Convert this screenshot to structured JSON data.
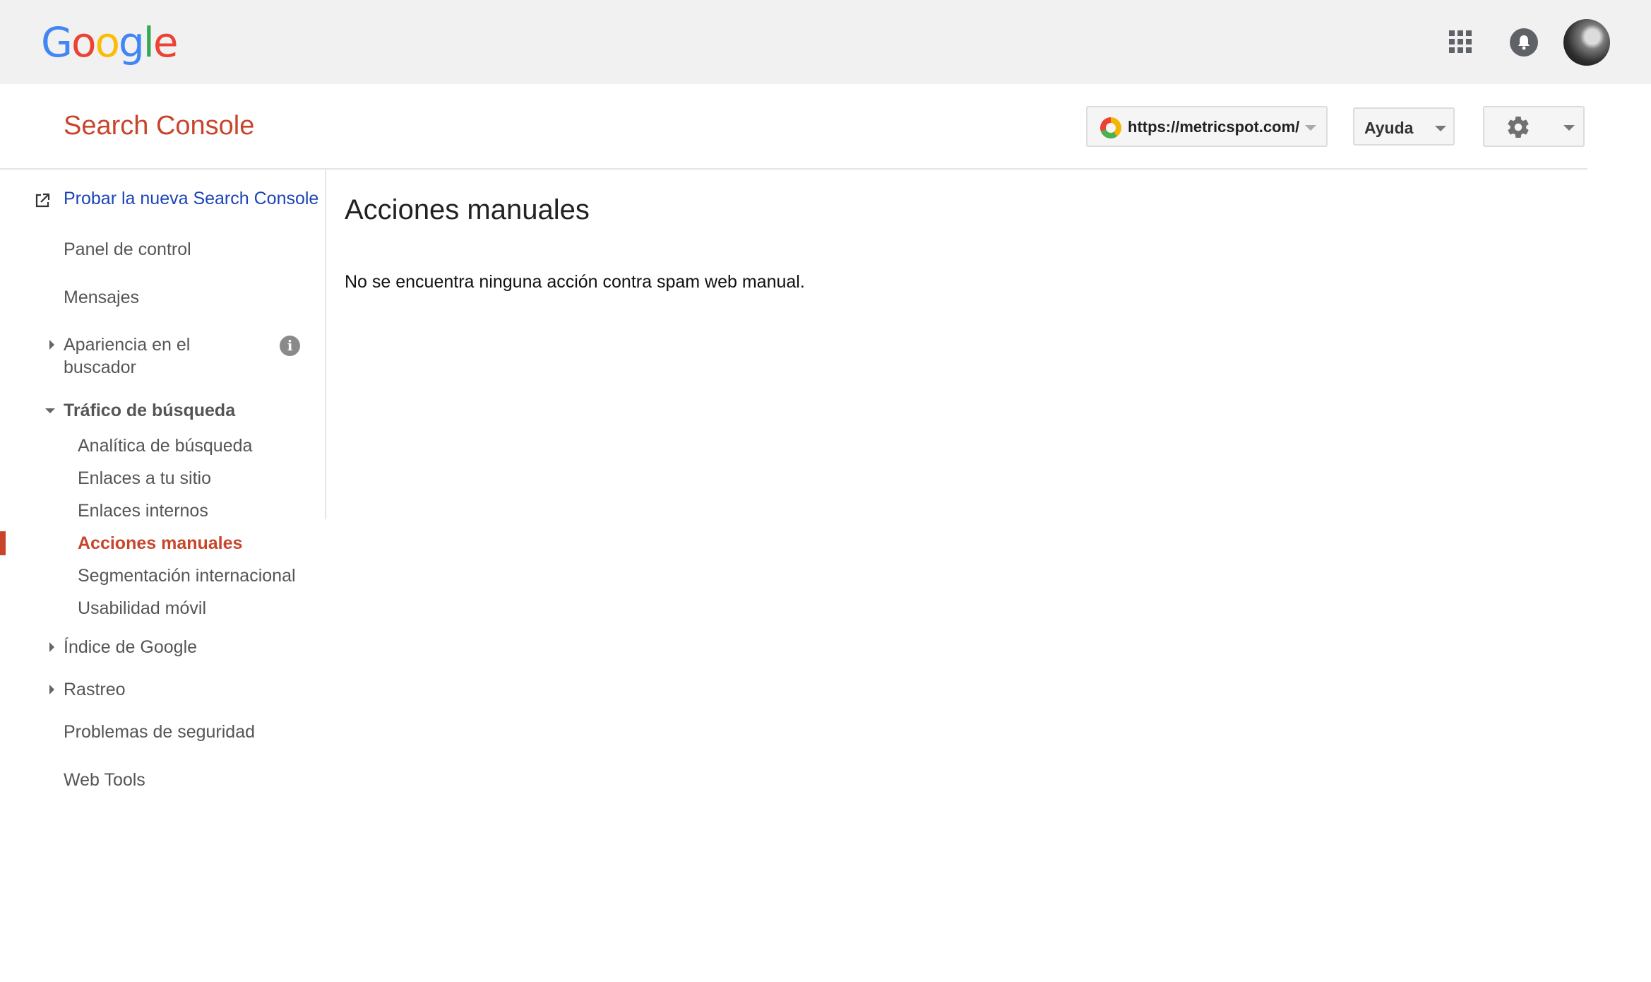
{
  "topbar": {
    "logo_letters": [
      "G",
      "o",
      "o",
      "g",
      "l",
      "e"
    ],
    "icons": {
      "apps": "apps-grid-icon",
      "notifications": "bell-icon",
      "account": "avatar"
    }
  },
  "header": {
    "product_title": "Search Console",
    "site_selector": "https://metricspot.com/",
    "help_label": "Ayuda",
    "settings_icon": "gear-icon"
  },
  "sidebar": {
    "new_console_link": "Probar la nueva Search Console",
    "items": {
      "panel": "Panel de control",
      "mensajes": "Mensajes",
      "apariencia_line1": "Apariencia en el",
      "apariencia_line2": "buscador",
      "trafico": "Tráfico de búsqueda",
      "analitica": "Analítica de búsqueda",
      "enlaces_sitio": "Enlaces a tu sitio",
      "enlaces_internos": "Enlaces internos",
      "acciones_manuales": "Acciones manuales",
      "segmentacion": "Segmentación internacional",
      "usabilidad": "Usabilidad móvil",
      "indice": "Índice de Google",
      "rastreo": "Rastreo",
      "seguridad": "Problemas de seguridad",
      "web_tools": "Web Tools"
    },
    "info_glyph": "i"
  },
  "main": {
    "title": "Acciones manuales",
    "message": "No se encuentra ninguna acción contra spam web manual."
  },
  "colors": {
    "brand_red": "#c8452c",
    "link_blue": "#1a44b8",
    "topbar_bg": "#f1f1f1"
  }
}
